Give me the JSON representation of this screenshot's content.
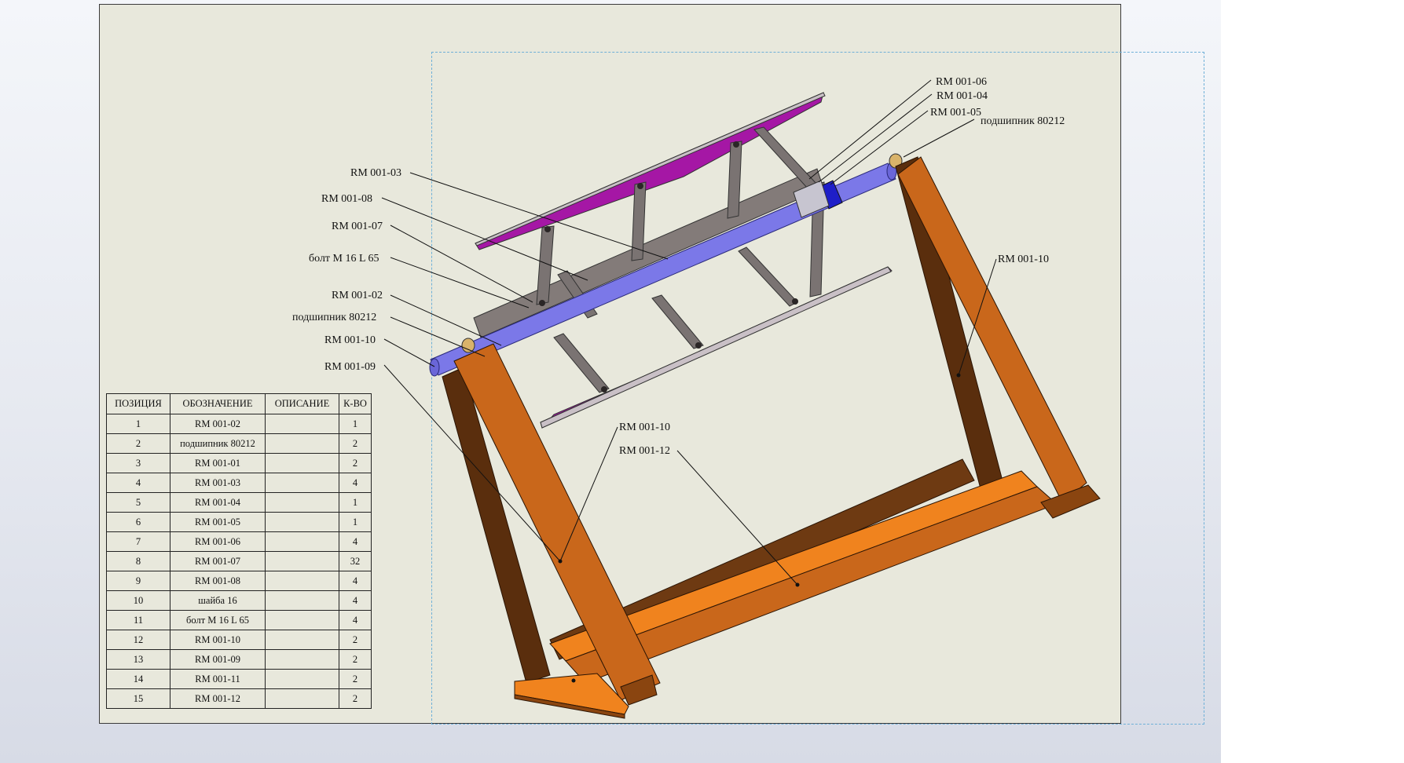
{
  "bom": {
    "headers": [
      "ПОЗИЦИЯ",
      "ОБОЗНАЧЕНИЕ",
      "ОПИСАНИЕ",
      "К-ВО"
    ],
    "rows": [
      {
        "pos": "1",
        "designation": "RM 001-02",
        "description": "",
        "qty": "1"
      },
      {
        "pos": "2",
        "designation": "подшипник 80212",
        "description": "",
        "qty": "2"
      },
      {
        "pos": "3",
        "designation": "RM 001-01",
        "description": "",
        "qty": "2"
      },
      {
        "pos": "4",
        "designation": "RM 001-03",
        "description": "",
        "qty": "4"
      },
      {
        "pos": "5",
        "designation": "RM 001-04",
        "description": "",
        "qty": "1"
      },
      {
        "pos": "6",
        "designation": "RM 001-05",
        "description": "",
        "qty": "1"
      },
      {
        "pos": "7",
        "designation": "RM 001-06",
        "description": "",
        "qty": "4"
      },
      {
        "pos": "8",
        "designation": "RM 001-07",
        "description": "",
        "qty": "32"
      },
      {
        "pos": "9",
        "designation": "RM 001-08",
        "description": "",
        "qty": "4"
      },
      {
        "pos": "10",
        "designation": "шайба 16",
        "description": "",
        "qty": "4"
      },
      {
        "pos": "11",
        "designation": "болт М 16 L 65",
        "description": "",
        "qty": "4"
      },
      {
        "pos": "12",
        "designation": "RM 001-10",
        "description": "",
        "qty": "2"
      },
      {
        "pos": "13",
        "designation": "RM 001-09",
        "description": "",
        "qty": "2"
      },
      {
        "pos": "14",
        "designation": "RM 001-11",
        "description": "",
        "qty": "2"
      },
      {
        "pos": "15",
        "designation": "RM 001-12",
        "description": "",
        "qty": "2"
      }
    ]
  },
  "callouts": {
    "rm_001_03": "RM 001-03",
    "rm_001_08": "RM 001-08",
    "rm_001_07": "RM 001-07",
    "bolt": "болт М 16 L 65",
    "rm_001_02": "RM 001-02",
    "bearing_left": "подшипник 80212",
    "rm_001_10_left": "RM 001-10",
    "rm_001_09": "RM 001-09",
    "rm_001_06": "RM 001-06",
    "rm_001_04": "RM 001-04",
    "rm_001_05": "RM 001-05",
    "bearing_right": "подшипник 80212",
    "rm_001_10_right": "RM 001-10",
    "rm_001_10_center": "RM 001-10",
    "rm_001_12": "RM 001-12"
  },
  "colors": {
    "frame_orange": "#c9671b",
    "frame_dark": "#5a2e0d",
    "shaft_blue": "#7b78e8",
    "blade_magenta": "#a517a5",
    "link_gray": "#7a7372",
    "sheet_bg": "#e8e8dc"
  }
}
